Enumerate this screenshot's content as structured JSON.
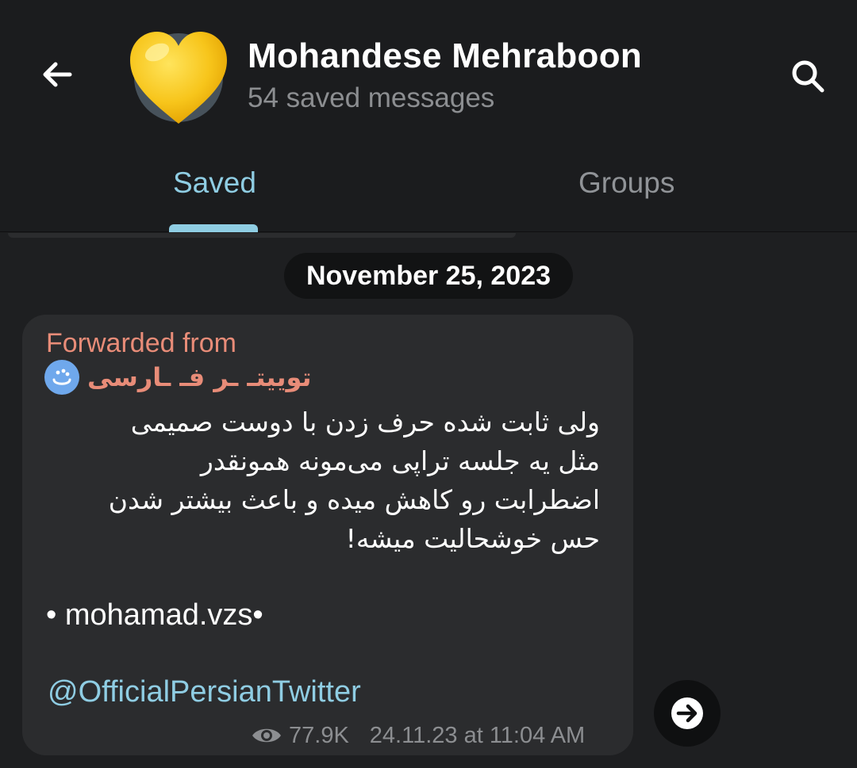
{
  "header": {
    "title": "Mohandese Mehraboon",
    "subtitle": "54 saved messages",
    "back_icon": "back-arrow-icon",
    "search_icon": "search-icon",
    "avatar_icon": "yellow-heart-icon"
  },
  "tabs": [
    {
      "label": "Saved",
      "active": true
    },
    {
      "label": "Groups",
      "active": false
    }
  ],
  "date_separator": "November 25, 2023",
  "message": {
    "forwarded_label": "Forwarded from",
    "forwarded_source": "توییتـ ـر فـ ـارسی",
    "text_lines": [
      "ولی ثابت شده حرف زدن با دوست صمیمی",
      "مثل یه جلسه تراپی می‌مونه همونقدر",
      "اضطرابت رو کاهش میده و باعث بیشتر شدن",
      "حس خوشحالیت میشه!"
    ],
    "author": "• mohamad.vzs•",
    "channel_link": "@OfficialPersianTwitter",
    "views": "77.9K",
    "timestamp": "24.11.23 at 11:04 AM"
  },
  "colors": {
    "accent": "#8fcde3",
    "forward": "#e88c78",
    "background": "#1e1f21",
    "bubble": "#2b2c2e"
  }
}
